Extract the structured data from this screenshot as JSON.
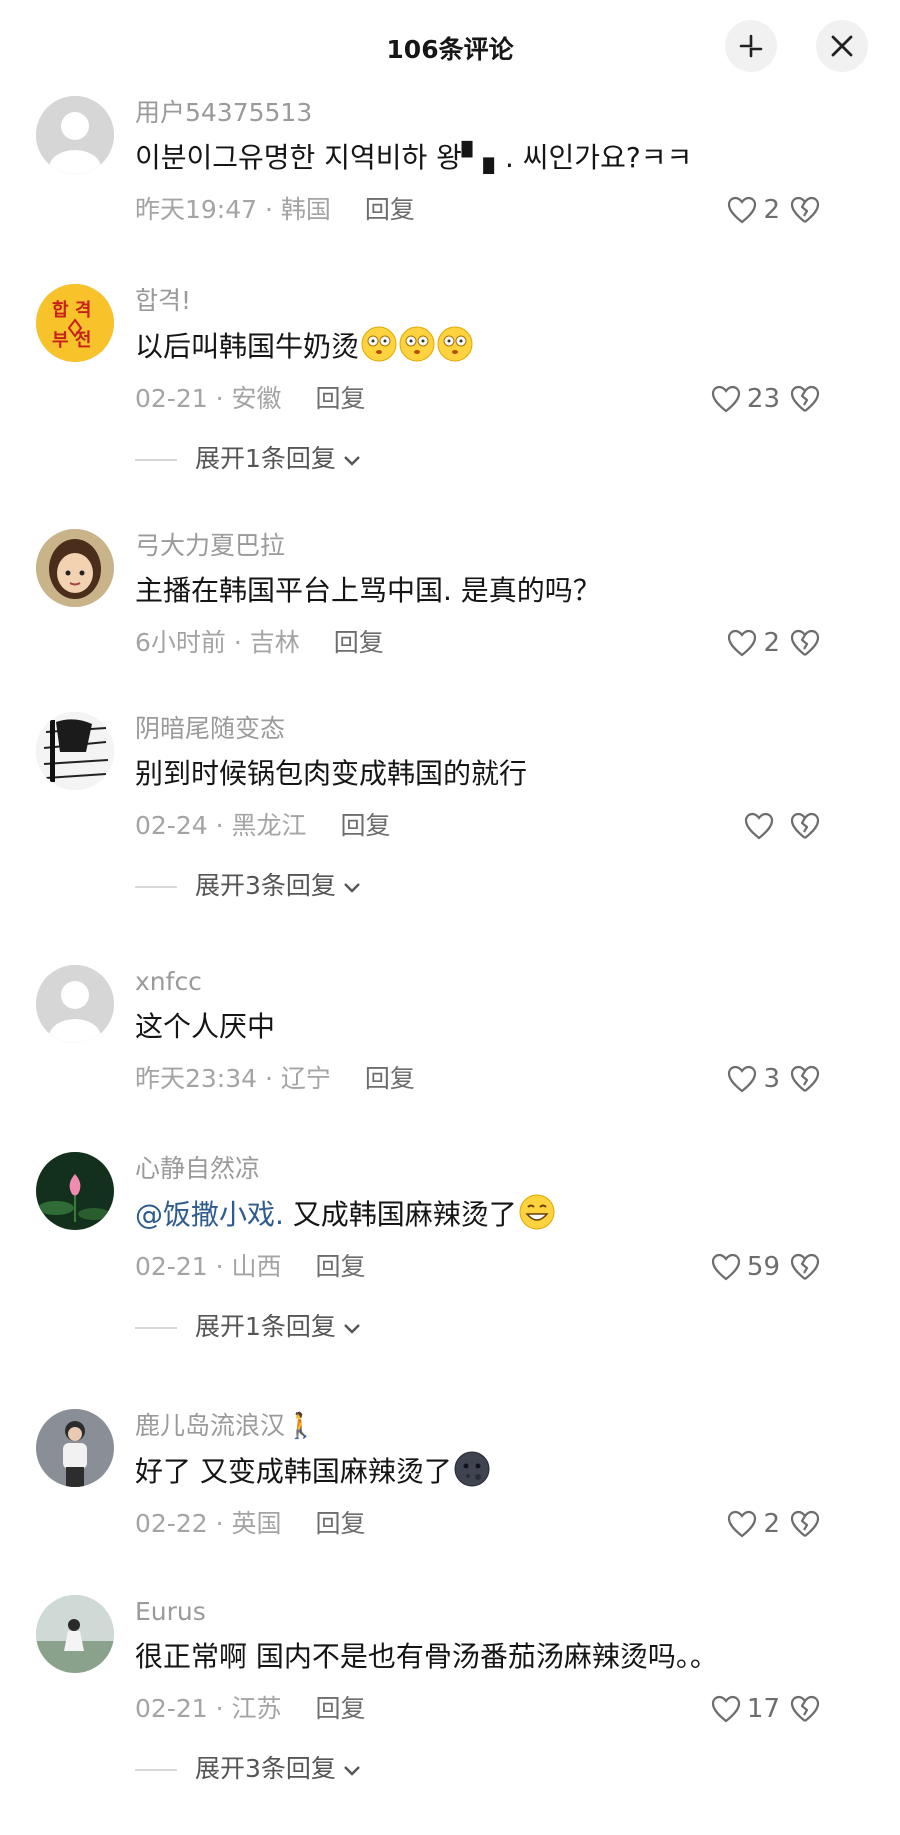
{
  "header": {
    "title": "106条评论"
  },
  "reply_label": "回复",
  "comments": [
    {
      "user": "用户54375513",
      "text": "이분이그유명한 지역비하 왕▘▖. 씨인가요?ㅋㅋ",
      "date": "昨天19:47 · 韩国",
      "likes": "2",
      "avatar": "default-avatar"
    },
    {
      "user": "합격!",
      "text": "以后叫韩国牛奶烫",
      "date": "02-21 · 安徽",
      "likes": "23",
      "expand": "展开1条回复",
      "avatar": "hapgyeok-avatar"
    },
    {
      "user": "弓大力夏巴拉",
      "text": "主播在韩国平台上骂中国. 是真的吗？",
      "date": "6小时前 · 吉林",
      "likes": "2",
      "avatar": "cartoon-girl-avatar"
    },
    {
      "user": "阴暗尾随变态",
      "text": "别到时候锅包肉变成韩国的就行",
      "date": "02-24 · 黑龙江",
      "likes": "",
      "expand": "展开3条回复",
      "avatar": "manga-avatar"
    },
    {
      "user": "xnfcc",
      "text": "这个人厌中",
      "date": "昨天23:34 · 辽宁",
      "likes": "3",
      "avatar": "default-avatar"
    },
    {
      "user": "心静自然凉",
      "mention": "@饭撒小戏.",
      "text": " 又成韩国麻辣烫了",
      "date": "02-21 · 山西",
      "likes": "59",
      "expand": "展开1条回复",
      "avatar": "lotus-avatar"
    },
    {
      "user": "鹿儿岛流浪汉🚶",
      "text": "好了 又变成韩国麻辣烫了",
      "date": "02-22 · 英国",
      "likes": "2",
      "avatar": "person-photo-avatar"
    },
    {
      "user": "Eurus",
      "text": "很正常啊 国内不是也有骨汤番茄汤麻辣烫吗。。",
      "date": "02-21 · 江苏",
      "likes": "17",
      "expand": "展开3条回复",
      "avatar": "landscape-avatar"
    }
  ]
}
